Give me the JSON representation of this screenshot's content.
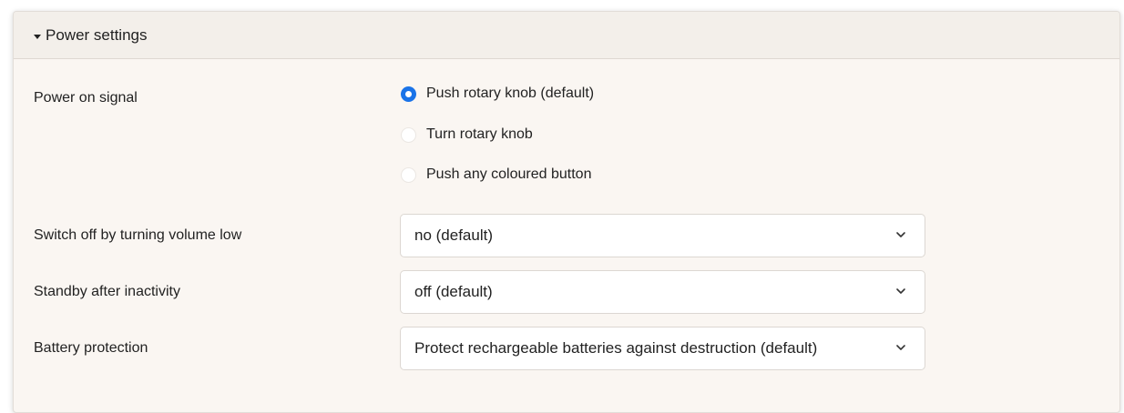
{
  "panel": {
    "title": "Power settings",
    "caret_icon": "caret-down-icon"
  },
  "power_on_signal": {
    "label": "Power on signal",
    "options": [
      {
        "label": "Push rotary knob (default)",
        "checked": true
      },
      {
        "label": "Turn rotary knob",
        "checked": false
      },
      {
        "label": "Push any coloured button",
        "checked": false
      }
    ]
  },
  "switch_off": {
    "label": "Switch off by turning volume low",
    "value": "no (default)"
  },
  "standby": {
    "label": "Standby after inactivity",
    "value": "off (default)"
  },
  "battery": {
    "label": "Battery protection",
    "value": "Protect rechargeable batteries against destruction (default)"
  },
  "colors": {
    "accent": "#1a73e8",
    "panel_bg": "#faf6f2",
    "header_bg": "#f3efea"
  }
}
